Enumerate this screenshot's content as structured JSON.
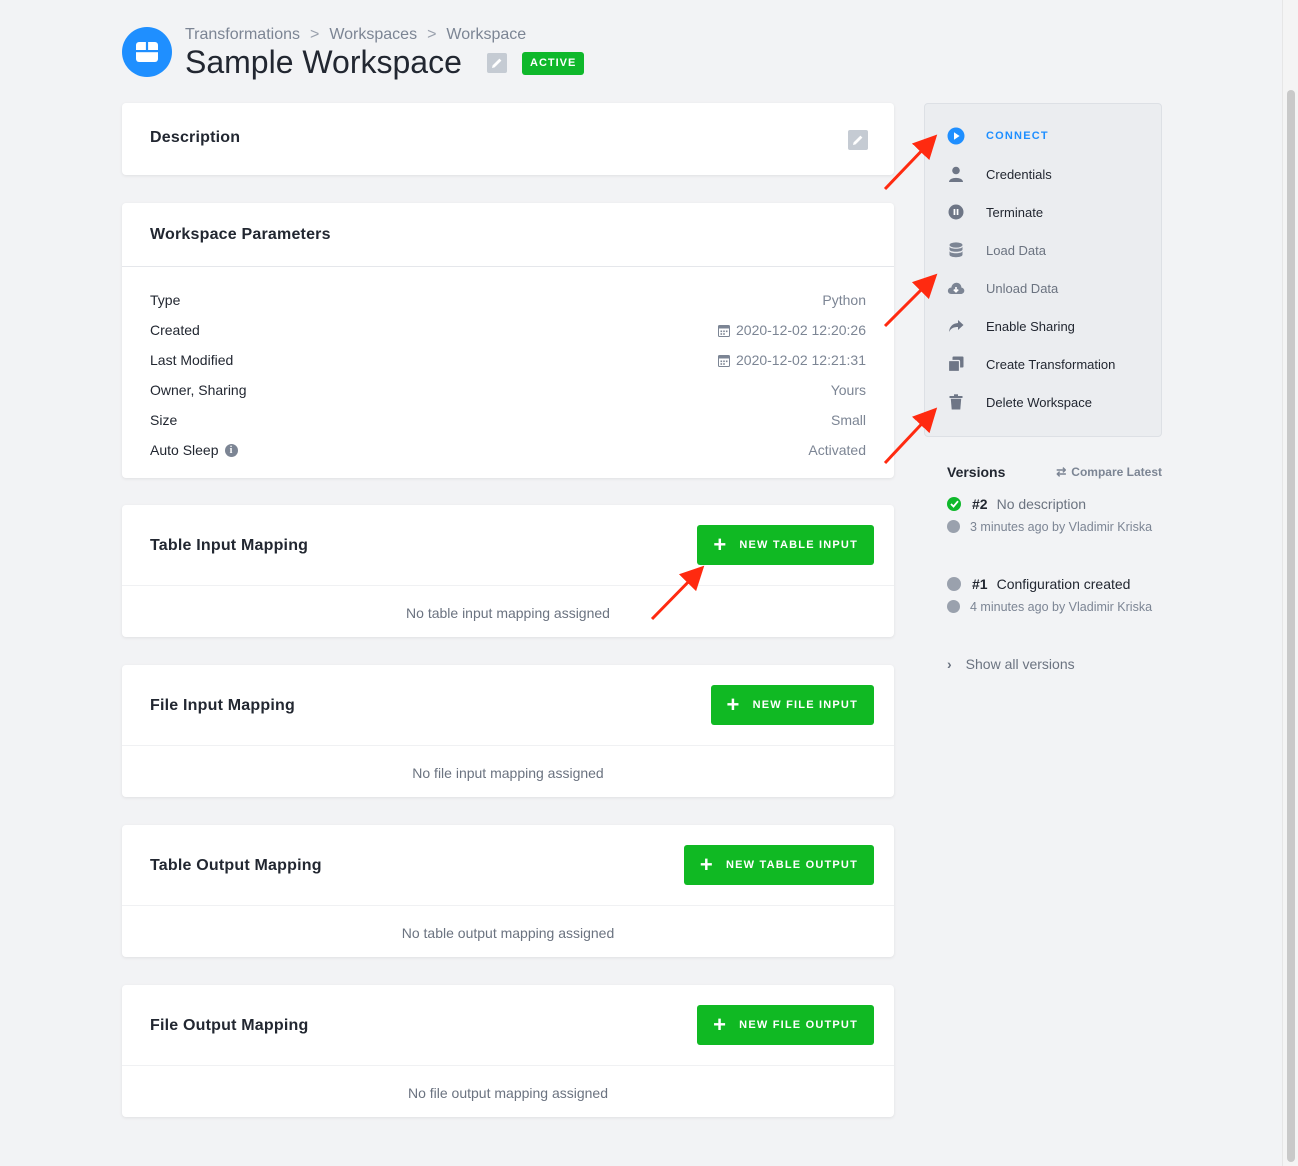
{
  "breadcrumb": {
    "items": [
      "Transformations",
      "Workspaces",
      "Workspace"
    ],
    "separator": ">"
  },
  "header": {
    "title": "Sample Workspace",
    "status": "ACTIVE",
    "app_icon": "workspace-icon",
    "edit_icon": "pencil-icon"
  },
  "description_card": {
    "title": "Description",
    "edit_icon": "pencil-icon"
  },
  "parameters": {
    "title": "Workspace Parameters",
    "rows": [
      {
        "label": "Type",
        "value": "Python"
      },
      {
        "label": "Created",
        "value": "2020-12-02 12:20:26",
        "icon": "calendar-icon"
      },
      {
        "label": "Last Modified",
        "value": "2020-12-02 12:21:31",
        "icon": "calendar-icon"
      },
      {
        "label": "Owner, Sharing",
        "value": "Yours"
      },
      {
        "label": "Size",
        "value": "Small"
      },
      {
        "label": "Auto Sleep",
        "value": "Activated",
        "label_icon": "info-icon"
      }
    ]
  },
  "mappings": [
    {
      "title": "Table Input Mapping",
      "button": "NEW TABLE INPUT",
      "empty": "No table input mapping assigned"
    },
    {
      "title": "File Input Mapping",
      "button": "NEW FILE INPUT",
      "empty": "No file input mapping assigned"
    },
    {
      "title": "Table Output Mapping",
      "button": "NEW TABLE OUTPUT",
      "empty": "No table output mapping assigned"
    },
    {
      "title": "File Output Mapping",
      "button": "NEW FILE OUTPUT",
      "empty": "No file output mapping assigned"
    }
  ],
  "side_menu": {
    "items": [
      {
        "label": "CONNECT",
        "icon": "play-circle-icon"
      },
      {
        "label": "Credentials",
        "icon": "user-icon"
      },
      {
        "label": "Terminate",
        "icon": "pause-circle-icon"
      },
      {
        "label": "Load Data",
        "icon": "database-icon"
      },
      {
        "label": "Unload Data",
        "icon": "cloud-download-icon"
      },
      {
        "label": "Enable Sharing",
        "icon": "share-icon"
      },
      {
        "label": "Create Transformation",
        "icon": "copy-icon"
      },
      {
        "label": "Delete Workspace",
        "icon": "trash-icon"
      }
    ]
  },
  "versions": {
    "title": "Versions",
    "compare": "Compare Latest",
    "list": [
      {
        "num": "#2",
        "desc": "No description",
        "meta": "3 minutes ago by Vladimir Kriska",
        "status": "current"
      },
      {
        "num": "#1",
        "desc": "Configuration created",
        "meta": "4 minutes ago by Vladimir Kriska",
        "status": "old"
      }
    ],
    "show_all": "Show all versions"
  },
  "colors": {
    "accent": "#1f8fff",
    "success": "#10b923",
    "annotation": "#ff2a10"
  }
}
